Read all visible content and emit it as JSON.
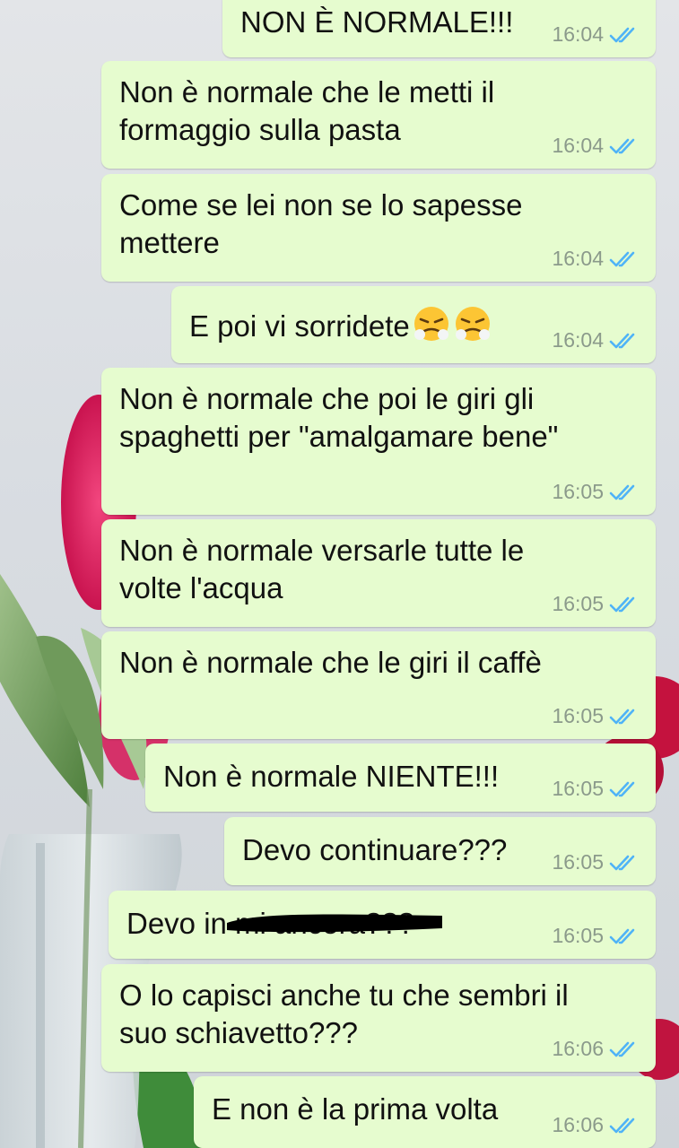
{
  "messages": [
    {
      "text": "NON È NORMALE!!!",
      "time": "16:04",
      "status": "read"
    },
    {
      "text": "Non è normale che le metti il\nformaggio sulla pasta",
      "time": "16:04",
      "status": "read"
    },
    {
      "text": "Come se lei non se lo sapesse\nmettere",
      "time": "16:04",
      "status": "read"
    },
    {
      "text": "E poi vi sorridete",
      "time": "16:04",
      "status": "read",
      "emoji": "face-with-steam-from-nose"
    },
    {
      "text": "Non è normale che poi le giri gli\nspaghetti per \"amalgamare bene\"",
      "time": "16:05",
      "status": "read"
    },
    {
      "text": "Non è normale versarle tutte le\nvolte l'acqua",
      "time": "16:05",
      "status": "read"
    },
    {
      "text": "Non è normale che le giri il caffè",
      "time": "16:05",
      "status": "read"
    },
    {
      "text": "Non è normale NIENTE!!!",
      "time": "16:05",
      "status": "read"
    },
    {
      "text": "Devo continuare???",
      "time": "16:05",
      "status": "read"
    },
    {
      "text": "Devo in           mi ancora???",
      "time": "16:05",
      "status": "read",
      "redacted": true
    },
    {
      "text": "O lo capisci anche tu che sembri il\nsuo schiavetto???",
      "time": "16:06",
      "status": "read"
    },
    {
      "text": "E non è la prima volta",
      "time": "16:06",
      "status": "read"
    }
  ],
  "colors": {
    "bubble_outgoing": "#e6fccf",
    "read_ticks": "#4fb3f7",
    "time_text": "#8b9a8b"
  },
  "icons": {
    "read_receipt": "double-check-icon",
    "emoji": "face-with-steam-from-nose"
  }
}
